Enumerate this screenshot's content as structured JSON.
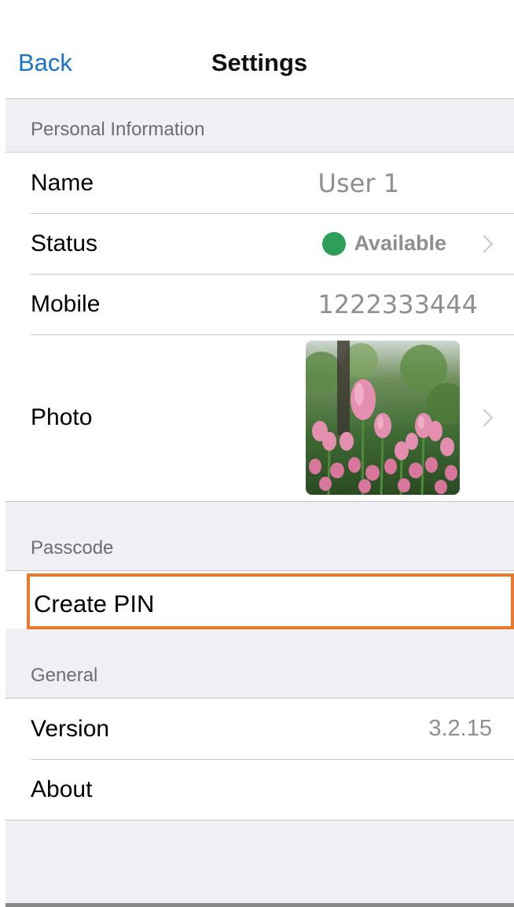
{
  "nav": {
    "back_label": "Back",
    "title": "Settings"
  },
  "sections": {
    "personal": {
      "header": "Personal Information",
      "name": {
        "label": "Name",
        "value": "User 1"
      },
      "status": {
        "label": "Status",
        "value": "Available",
        "color": "#2e9e5b"
      },
      "mobile": {
        "label": "Mobile",
        "value": "1222333444"
      },
      "photo": {
        "label": "Photo",
        "icon": "tulip-photo"
      }
    },
    "passcode": {
      "header": "Passcode",
      "create_pin": {
        "label": "Create PIN",
        "highlight_color": "#ea7a2a"
      }
    },
    "general": {
      "header": "General",
      "version": {
        "label": "Version",
        "value": "3.2.15"
      },
      "about": {
        "label": "About"
      }
    }
  },
  "colors": {
    "accent": "#1a73c8",
    "background": "#efeff4"
  }
}
